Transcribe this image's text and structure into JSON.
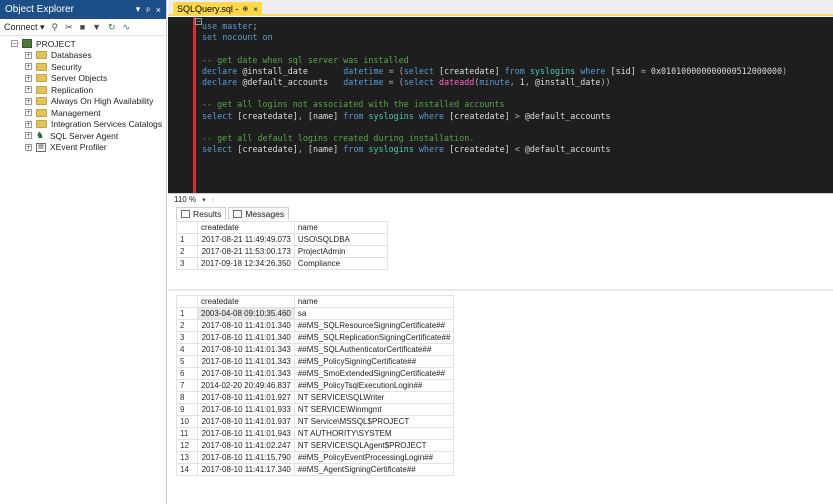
{
  "object_explorer": {
    "title": "Object Explorer",
    "controls": [
      "▾",
      "ᵖ",
      "×"
    ],
    "toolbar": {
      "connect": "Connect ▾",
      "icons": [
        "connect-object-icon",
        "disconnect-icon",
        "stop-icon",
        "filter-icon",
        "refresh-icon",
        "activity-icon"
      ]
    },
    "root": "PROJECT",
    "items": [
      "Databases",
      "Security",
      "Server Objects",
      "Replication",
      "Always On High Availability",
      "Management",
      "Integration Services Catalogs",
      "SQL Server Agent",
      "XEvent Profiler"
    ]
  },
  "document_tab": {
    "label": "SQLQuery.sql -",
    "pin": "⊕",
    "close": "×"
  },
  "editor": {
    "lines": [
      "use master;",
      "set nocount on",
      "",
      "-- get date when sql server was installed",
      "declare @install_date       datetime = (select [createdate] from syslogins where [sid] = 0x010100000000000512000000)",
      "declare @default_accounts   datetime = (select dateadd(minute, 1, @install_date))",
      "",
      "-- get all logins not associated with the installed accounts",
      "select [createdate], [name] from syslogins where [createdate] > @default_accounts",
      "",
      "-- get all default logins created during installation.",
      "select [createdate], [name] from syslogins where [createdate] < @default_accounts"
    ]
  },
  "status": {
    "zoom": "110 %",
    "zoom_arrow": "▾"
  },
  "results_tabs": [
    "Results",
    "Messages"
  ],
  "result1": {
    "columns": [
      "createdate",
      "name"
    ],
    "rows": [
      [
        "1",
        "2017-08-21 11:49:49.073",
        "USO\\SQLDBA"
      ],
      [
        "2",
        "2017-08-21 11:53:00.173",
        "ProjectAdmin"
      ],
      [
        "3",
        "2017-09-18 12:34:26.350",
        "Compliance"
      ]
    ]
  },
  "result2": {
    "columns": [
      "createdate",
      "name"
    ],
    "rows": [
      [
        "1",
        "2003-04-08 09:10:35.460",
        "sa"
      ],
      [
        "2",
        "2017-08-10 11:41:01.340",
        "##MS_SQLResourceSigningCertificate##"
      ],
      [
        "3",
        "2017-08-10 11:41:01.340",
        "##MS_SQLReplicationSigningCertificate##"
      ],
      [
        "4",
        "2017-08-10 11:41:01.343",
        "##MS_SQLAuthenticatorCertificate##"
      ],
      [
        "5",
        "2017-08-10 11:41:01.343",
        "##MS_PolicySigningCertificate##"
      ],
      [
        "6",
        "2017-08-10 11:41:01.343",
        "##MS_SmoExtendedSigningCertificate##"
      ],
      [
        "7",
        "2014-02-20 20:49:46.837",
        "##MS_PolicyTsqlExecutionLogin##"
      ],
      [
        "8",
        "2017-08-10 11:41:01.927",
        "NT SERVICE\\SQLWriter"
      ],
      [
        "9",
        "2017-08-10 11:41:01.933",
        "NT SERVICE\\Winmgmt"
      ],
      [
        "10",
        "2017-08-10 11:41:01.937",
        "NT Service\\MSSQL$PROJECT"
      ],
      [
        "11",
        "2017-08-10 11:41:01.943",
        "NT AUTHORITY\\SYSTEM"
      ],
      [
        "12",
        "2017-08-10 11:41:02.247",
        "NT SERVICE\\SQLAgent$PROJECT"
      ],
      [
        "13",
        "2017-08-10 11:41:15.790",
        "##MS_PolicyEventProcessingLogin##"
      ],
      [
        "14",
        "2017-08-10 11:41:17.340",
        "##MS_AgentSigningCertificate##"
      ]
    ]
  },
  "colors": {
    "title_bar": "#1c4e87",
    "editor_bg": "#1e1e1e",
    "tab_accent": "#ffd84b",
    "keyword": "#569cd6",
    "comment": "#57a64a",
    "function": "#ff66cc"
  }
}
